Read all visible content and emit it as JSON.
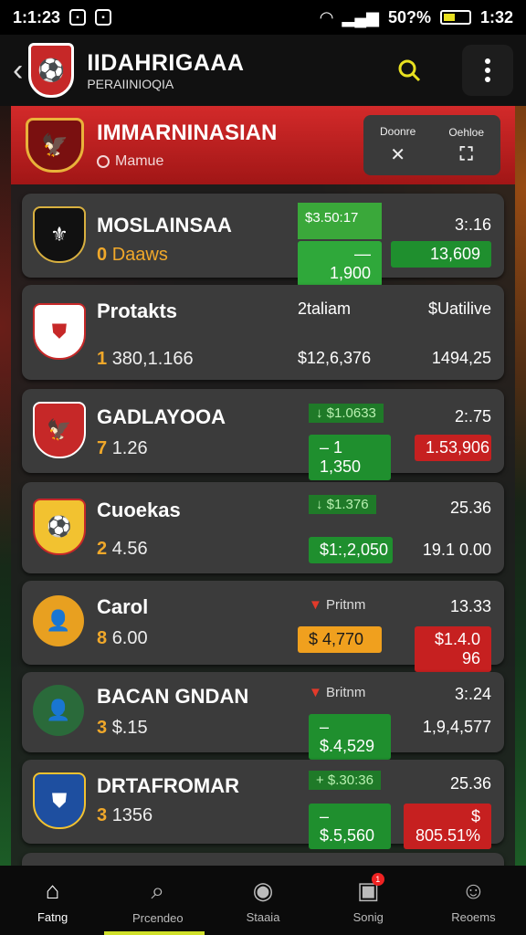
{
  "status_bar": {
    "time_left": "1:1:23",
    "battery": "50?%",
    "time_right": "1:32"
  },
  "app_bar": {
    "title": "IIDAHRIGAAA",
    "subtitle": "PERAIINIOQIA"
  },
  "league": {
    "name": "IMMARNINASIAN",
    "subtitle": "Mamue",
    "actions": [
      {
        "label": "Doonre"
      },
      {
        "label": "Oehloe"
      }
    ]
  },
  "rows": [
    {
      "name": "MOSLAINSAA",
      "rank": "0",
      "value": "Daaws",
      "tag": "$3.50:17",
      "col2": "3:.16",
      "pill1": "— 1,900",
      "pill2": "13,609"
    },
    {
      "name": "Protakts",
      "rank": "1",
      "value": "380,1.166",
      "col1_head": "2taliam",
      "col2_head": "$Uatilive",
      "col1": "$12,6,376",
      "col2": "1494,25"
    },
    {
      "name": "GADLAYOOA",
      "rank": "7",
      "value": "1.26",
      "tag": "↓ $1.0633",
      "col2": "2:.75",
      "pill1": "– 1 1,350",
      "pill2": "1.53,906"
    },
    {
      "name": "Cuoekas",
      "rank": "2",
      "value": "4.56",
      "tag": "↓ $1.376",
      "col2": "25.36",
      "pill1": "$1:,2,050",
      "col2b": "19.1 0.00"
    },
    {
      "name": "Carol",
      "rank": "8",
      "value": "6.00",
      "tag": "Pritnm",
      "col2": "13.33",
      "pill1": "$  4,770",
      "pill2": "$1.4.0 96"
    },
    {
      "name": "BACAN GNDAN",
      "rank": "3",
      "value": "$.15",
      "tag": "Britnm",
      "col2": "3:.24",
      "pill1": "– $.4,529",
      "col2b": "1,9,4,577"
    },
    {
      "name": "DRTAFROMAR",
      "rank": "3",
      "value": "1356",
      "tag": "+ $.30:36",
      "col2": "25.36",
      "pill1": "– $.5,560",
      "pill2": "$ 805.51%"
    }
  ],
  "bottom_nav": [
    {
      "label": "Fatng",
      "icon": "home-icon"
    },
    {
      "label": "Prcendeo",
      "icon": "search-icon"
    },
    {
      "label": "Staaia",
      "icon": "play-icon"
    },
    {
      "label": "Sonig",
      "icon": "scoreboard-icon",
      "badge": "1"
    },
    {
      "label": "Reoems",
      "icon": "user-icon"
    }
  ],
  "colors": {
    "accent_red": "#c62828",
    "accent_green": "#1f8f2e",
    "accent_orange": "#f0a01e",
    "nav_indicator": "#d0e02a"
  }
}
